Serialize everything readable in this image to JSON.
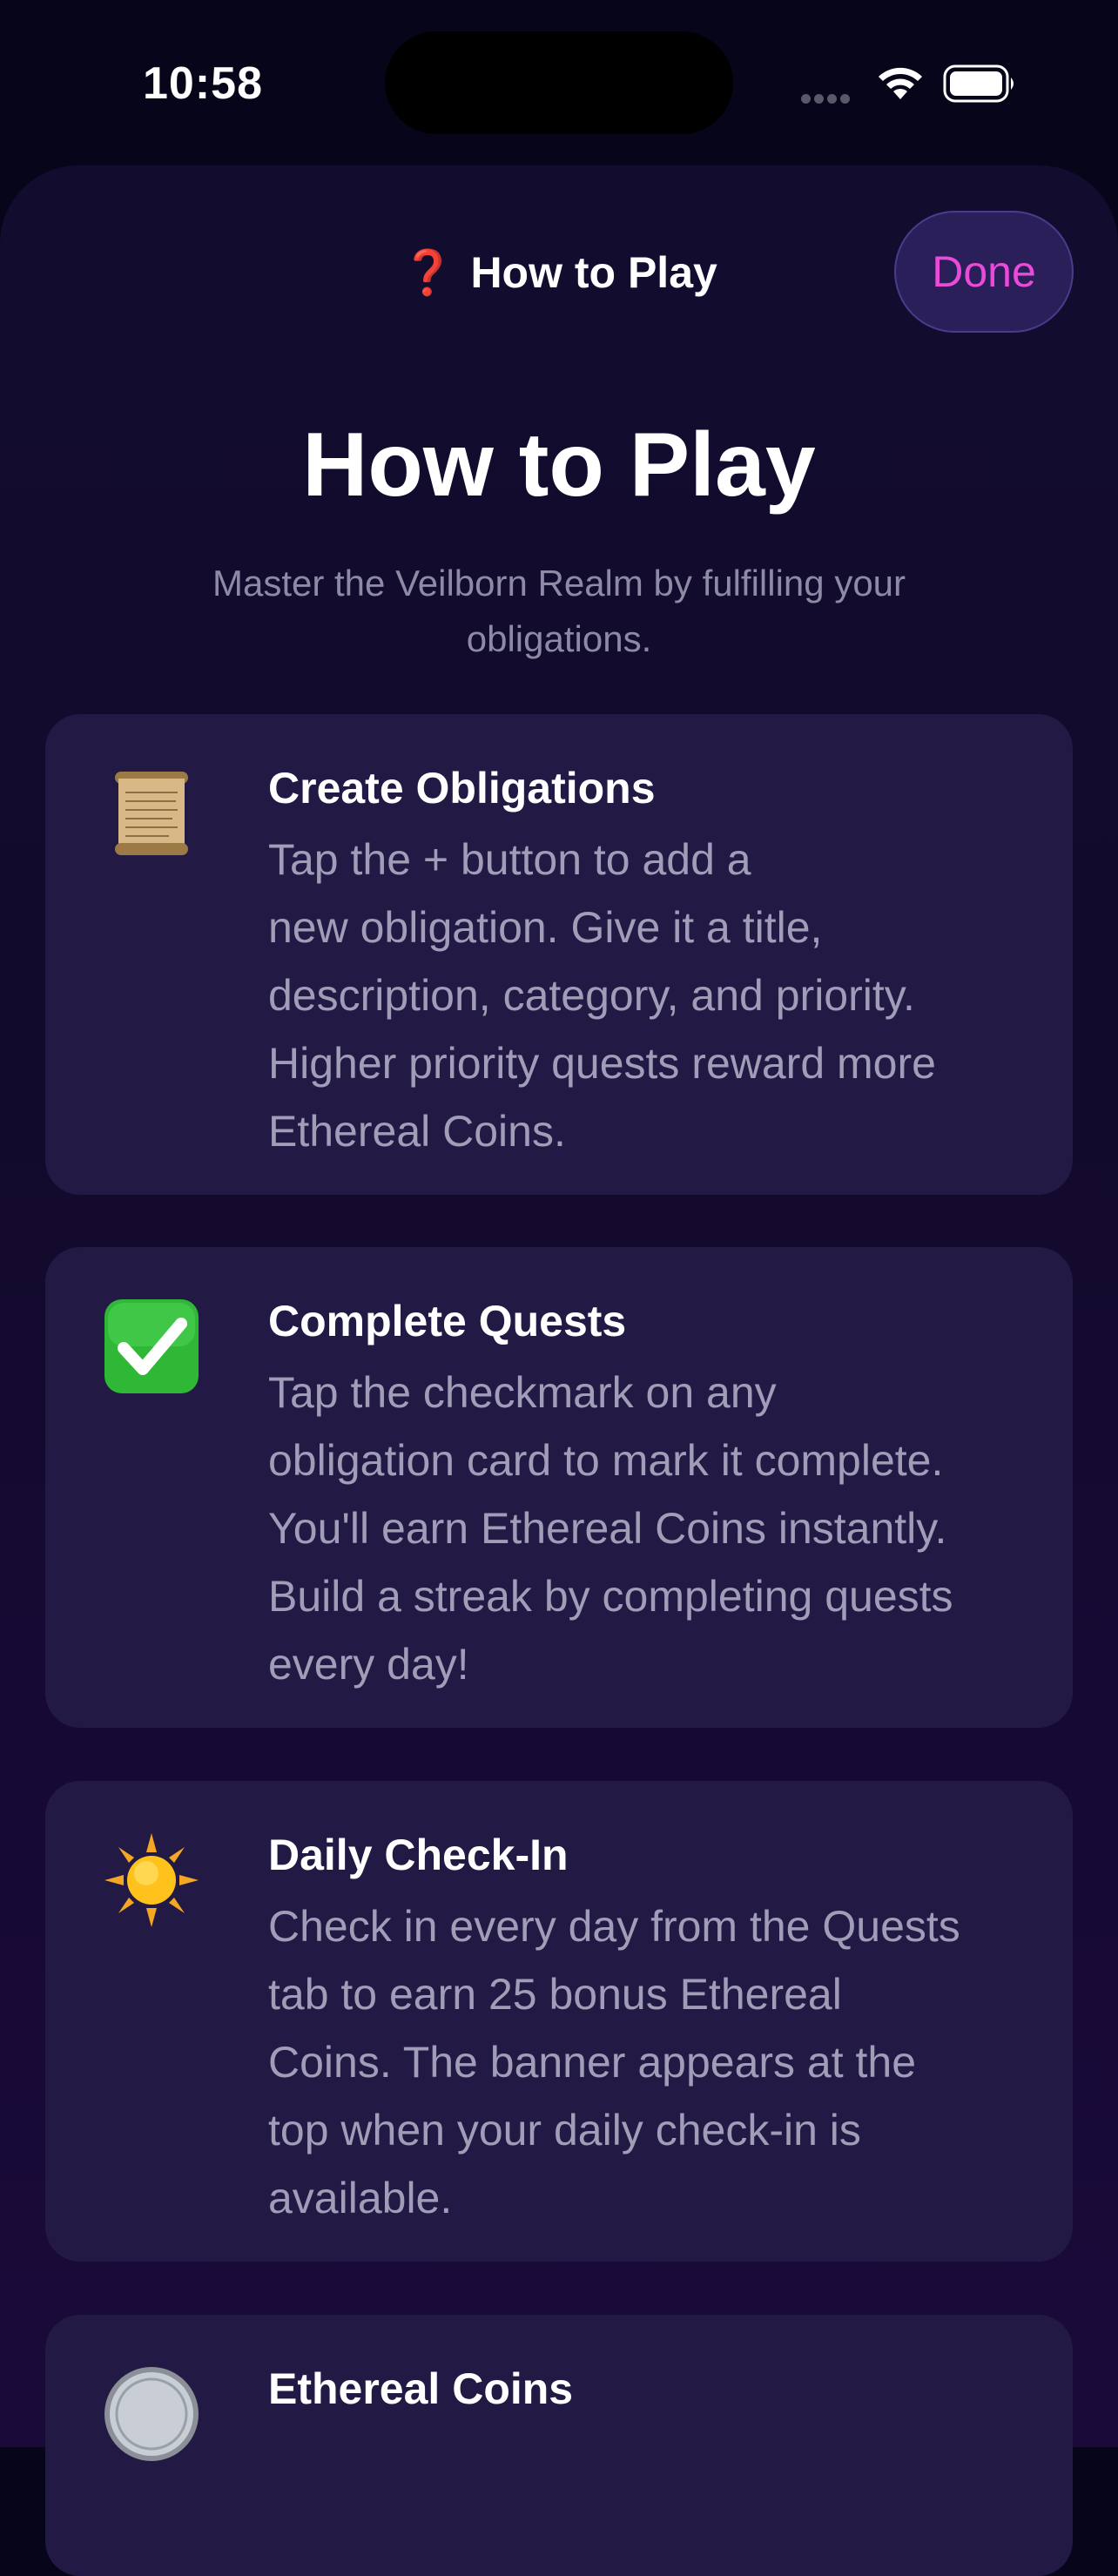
{
  "status": {
    "time": "10:58"
  },
  "nav": {
    "icon": "❓",
    "title": "How to Play",
    "done_label": "Done"
  },
  "page": {
    "title": "How to Play",
    "subtitle": "Master the Veilborn Realm by fulfilling your obligations."
  },
  "cards": [
    {
      "icon": "scroll-icon",
      "title": "Create Obligations",
      "lines": [
        "Tap the + button to add a",
        "new obligation. Give it a title,",
        "description, category, and priority.",
        "Higher priority quests reward more",
        "Ethereal Coins."
      ]
    },
    {
      "icon": "check-mark-icon",
      "title": "Complete Quests",
      "lines": [
        "Tap the checkmark on any",
        "obligation card to mark it complete.",
        "You'll earn Ethereal Coins instantly.",
        "Build a streak by completing quests",
        "every day!"
      ]
    },
    {
      "icon": "sun-icon",
      "title": "Daily Check-In",
      "lines": [
        "Check in every day from the Quests",
        "tab to earn 25 bonus Ethereal",
        "Coins. The banner appears at the",
        "top when your daily check-in is",
        "available."
      ]
    },
    {
      "icon": "coin-icon",
      "title": "Ethereal Coins",
      "lines": []
    }
  ],
  "colors": {
    "accent": "#e94bd8",
    "card_bg": "#221a44",
    "body_text": "#a19db8"
  }
}
